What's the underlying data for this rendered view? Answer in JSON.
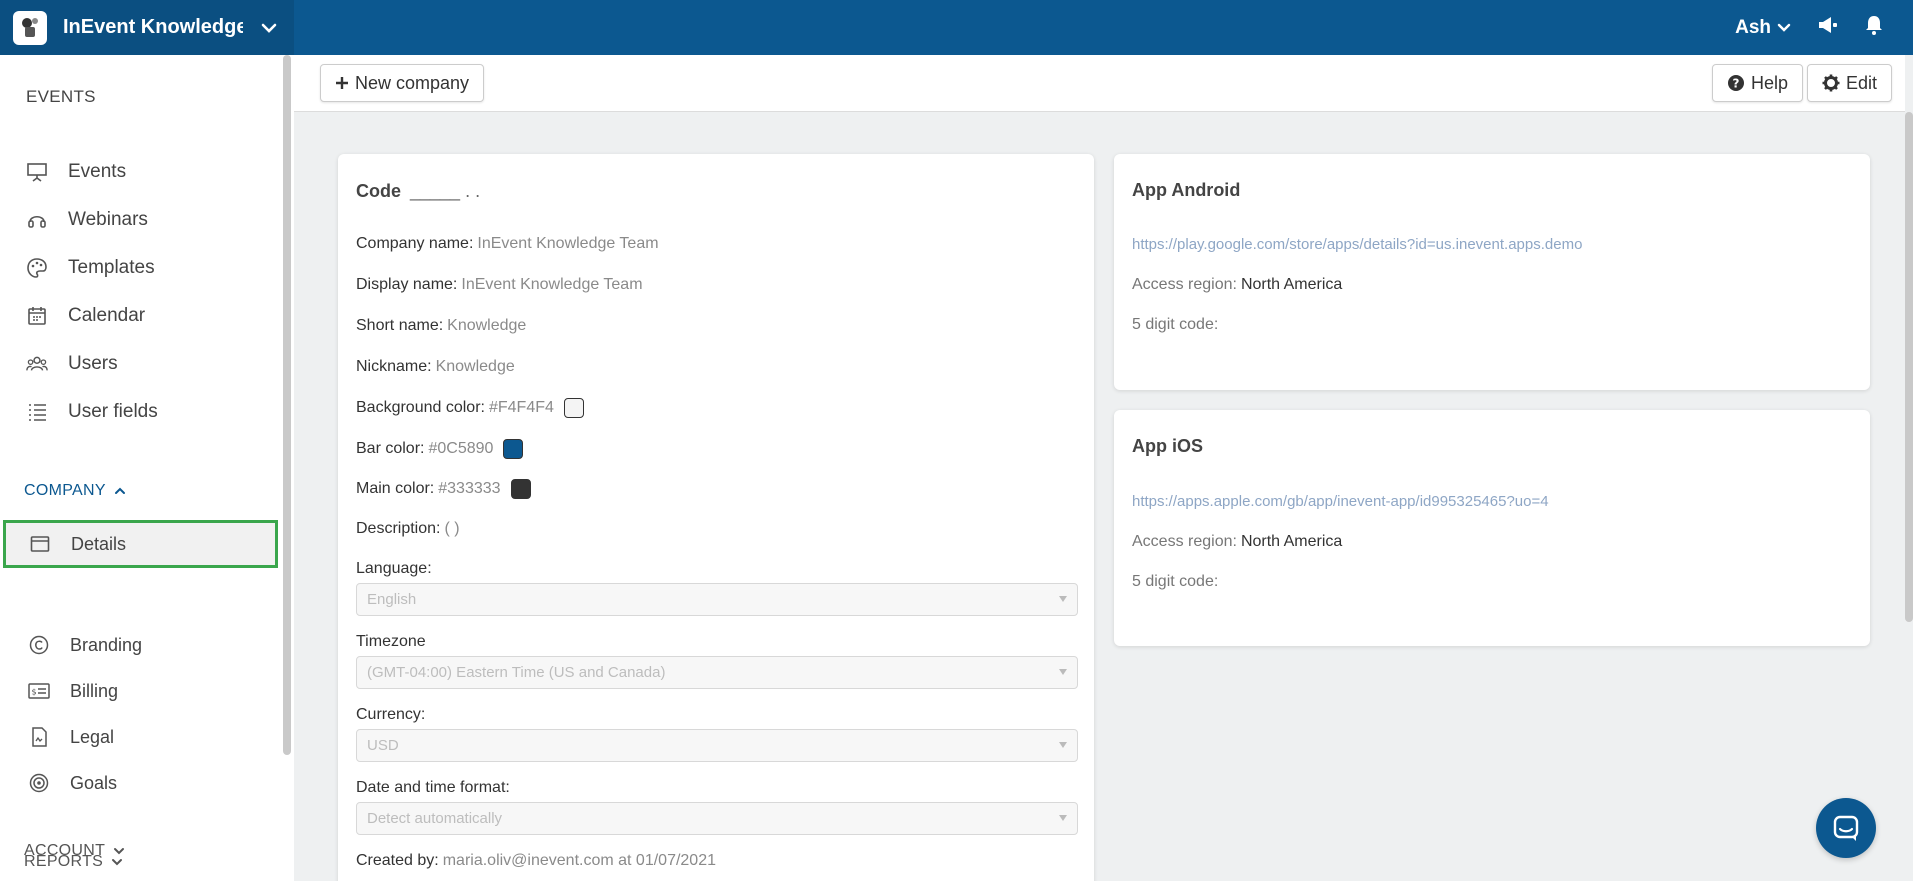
{
  "app": {
    "title": "InEvent Knowledge ..."
  },
  "topbar": {
    "user": "Ash"
  },
  "sidebar": {
    "events_title": "EVENTS",
    "events_items": [
      {
        "label": "Events",
        "icon": "presentation-icon"
      },
      {
        "label": "Webinars",
        "icon": "headset-icon"
      },
      {
        "label": "Templates",
        "icon": "palette-icon"
      },
      {
        "label": "Calendar",
        "icon": "calendar-icon"
      },
      {
        "label": "Users",
        "icon": "users-icon"
      },
      {
        "label": "User fields",
        "icon": "list-icon"
      }
    ],
    "company_title": "COMPANY",
    "company_items": [
      {
        "label": "Details",
        "icon": "window-icon",
        "active": true
      },
      {
        "label": "Branding",
        "icon": "copyright-icon"
      },
      {
        "label": "Billing",
        "icon": "billing-icon"
      },
      {
        "label": "Legal",
        "icon": "document-icon"
      },
      {
        "label": "Goals",
        "icon": "target-icon"
      }
    ],
    "account_title": "ACCOUNT",
    "reports_title": "REPORTS"
  },
  "toolbar": {
    "new_company": "New company",
    "help": "Help",
    "edit": "Edit"
  },
  "details": {
    "code_label": "Code",
    "code_value": "_____ . .",
    "fields": [
      {
        "label": "Company name:",
        "value": "InEvent Knowledge Team"
      },
      {
        "label": "Display name:",
        "value": "InEvent Knowledge Team"
      },
      {
        "label": "Short name:",
        "value": "Knowledge"
      },
      {
        "label": "Nickname:",
        "value": "Knowledge"
      }
    ],
    "background_color": {
      "label": "Background color:",
      "value": "#F4F4F4"
    },
    "bar_color": {
      "label": "Bar color:",
      "value": "#0C5890"
    },
    "main_color": {
      "label": "Main color:",
      "value": "#333333"
    },
    "description": {
      "label": "Description:",
      "value": "( )"
    },
    "language": {
      "label": "Language:",
      "value": "English"
    },
    "timezone": {
      "label": "Timezone",
      "value": "(GMT-04:00) Eastern Time (US and Canada)"
    },
    "currency": {
      "label": "Currency:",
      "value": "USD"
    },
    "datetime_format": {
      "label": "Date and time format:",
      "value": "Detect automatically"
    },
    "created_by": {
      "label": "Created by:",
      "value": "maria.oliv@inevent.com at 01/07/2021"
    }
  },
  "android": {
    "title": "App Android",
    "url": "https://play.google.com/store/apps/details?id=us.inevent.apps.demo",
    "region_label": "Access region:",
    "region_value": "North America",
    "code_label": "5 digit code:"
  },
  "ios": {
    "title": "App iOS",
    "url": "https://apps.apple.com/gb/app/inevent-app/id995325465?uo=4",
    "region_label": "Access region:",
    "region_value": "North America",
    "code_label": "5 digit code:"
  },
  "colors": {
    "bar": "#0C5890",
    "accent_green": "#3AA64C"
  }
}
